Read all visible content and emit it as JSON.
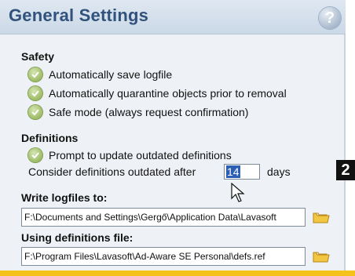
{
  "header": {
    "title": "General Settings",
    "help_glyph": "?"
  },
  "safety": {
    "title": "Safety",
    "options": [
      "Automatically save logfile",
      "Automatically quarantine objects prior to removal",
      "Safe mode (always request confirmation)"
    ]
  },
  "definitions": {
    "title": "Definitions",
    "prompt_option": "Prompt to update outdated definitions",
    "outdated_label": "Consider definitions outdated after",
    "outdated_value": "14",
    "outdated_unit": "days"
  },
  "logfiles": {
    "label": "Write logfiles to:",
    "path": "F:\\Documents and Settings\\Gergő\\Application Data\\Lavasoft"
  },
  "defs_file": {
    "label": "Using definitions file:",
    "path": "F:\\Program Files\\Lavasoft\\Ad-Aware SE Personal\\defs.ref"
  },
  "badge": "2",
  "colors": {
    "header_text": "#31527c",
    "check_green": "#9cbc63",
    "folder_yellow": "#f2c640",
    "accent_bar": "#f4c21a"
  },
  "icons": [
    "help-icon",
    "check-icon",
    "folder-icon",
    "mouse-cursor-icon"
  ]
}
